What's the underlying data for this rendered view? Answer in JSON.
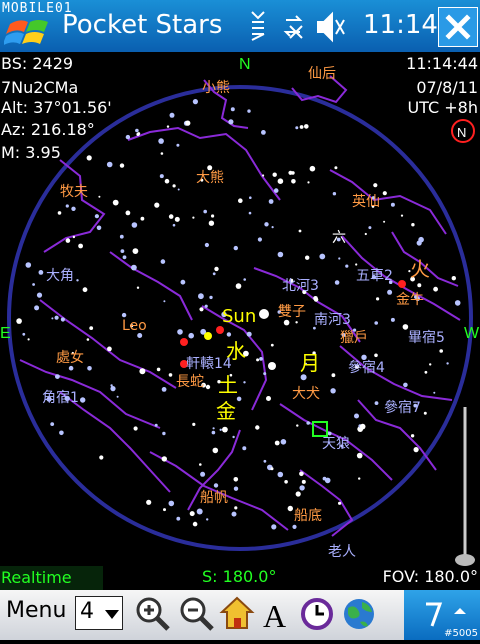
{
  "system": {
    "carrier": "MOBILE01",
    "clock": "11:14"
  },
  "app": {
    "title": "Pocket Stars"
  },
  "info": {
    "bright_stars": "BS: 2429",
    "star_name": "7Nu2CMa",
    "altitude": "Alt:  37°01.56'",
    "azimuth": "Az:  216.18°",
    "magnitude": "M: 3.95",
    "time": "11:14:44",
    "date": "07/8/11",
    "utc": "UTC +8h"
  },
  "compass": {
    "north": "N",
    "east": "E",
    "west": "W"
  },
  "sky_labels": {
    "xiaoxiong": "小熊",
    "xianhou": "仙后",
    "dazxiong": "大熊",
    "muxu": "牧夫",
    "yingxian": "英仙",
    "liufu": "六",
    "dajiao": "大角",
    "wuche": "五車2",
    "huo": "火",
    "jinniu": "金牛",
    "beihe": "北河3",
    "nanhe": "南河3",
    "shuangzi": "雙子",
    "sun": "Sun",
    "shui": "水",
    "leo": "Leo",
    "chudv": "處女",
    "xuanyuan": "軒轅14",
    "changshe": "長蛇",
    "tu": "土",
    "jin": "金",
    "yue": "月",
    "liehu": "獵戶",
    "shensu4": "參宿4",
    "bisu": "畢宿5",
    "dadu": "大犬",
    "tianlang": "天狼",
    "shensu7": "參宿7",
    "jiaosu": "角宿1",
    "chuanfan": "船帆",
    "chuandi": "船底",
    "laoren": "老人"
  },
  "status": {
    "mode": "Realtime",
    "south": "S: 180.0°",
    "fov": "FOV: 180.0°"
  },
  "menu": {
    "label": "Menu",
    "zoom_value": "4"
  },
  "icons": [
    "windows-logo",
    "signal-icon",
    "sync-icon",
    "volume-icon",
    "close-icon",
    "zoom-in-icon",
    "zoom-out-icon",
    "home-icon",
    "font-icon",
    "clock-icon",
    "globe-icon",
    "rotate-icon"
  ],
  "colors": {
    "constellation": "#a040ff",
    "label": "#ff9a44",
    "planet": "#ffff00",
    "sky_border": "#2a2d9a",
    "highlight": "#22ff22"
  },
  "corner_tag": "#5005"
}
